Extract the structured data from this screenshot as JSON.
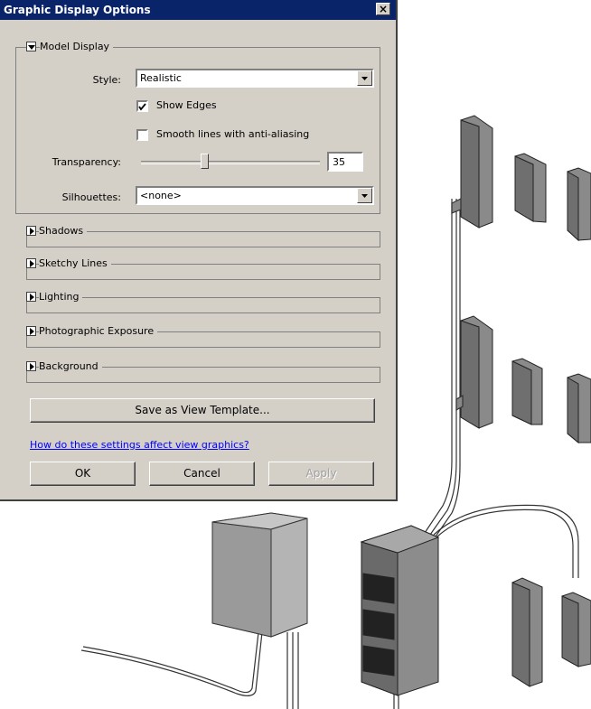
{
  "dialog": {
    "title": "Graphic Display Options",
    "close_symbol": "×"
  },
  "model_display": {
    "section_label": "Model Display",
    "style_label": "Style:",
    "style_value": "Realistic",
    "show_edges_label": "Show Edges",
    "show_edges_checked": true,
    "smooth_lines_label": "Smooth lines with anti-aliasing",
    "smooth_lines_checked": false,
    "transparency_label": "Transparency:",
    "transparency_value": "35",
    "transparency_level": 0.35,
    "silhouettes_label": "Silhouettes:",
    "silhouettes_value": "<none>"
  },
  "sections": {
    "shadows": "Shadows",
    "sketchy_lines": "Sketchy Lines",
    "lighting": "Lighting",
    "photographic_exposure": "Photographic Exposure",
    "background": "Background"
  },
  "actions": {
    "save_template": "Save as View Template...",
    "help_link": "How do these settings affect view graphics?",
    "ok": "OK",
    "cancel": "Cancel",
    "apply": "Apply"
  },
  "icons": {
    "collapse": "triangle-down-icon",
    "expand": "triangle-right-icon",
    "dropdown": "dropdown-arrow-icon",
    "check": "check-icon",
    "close": "close-icon"
  }
}
